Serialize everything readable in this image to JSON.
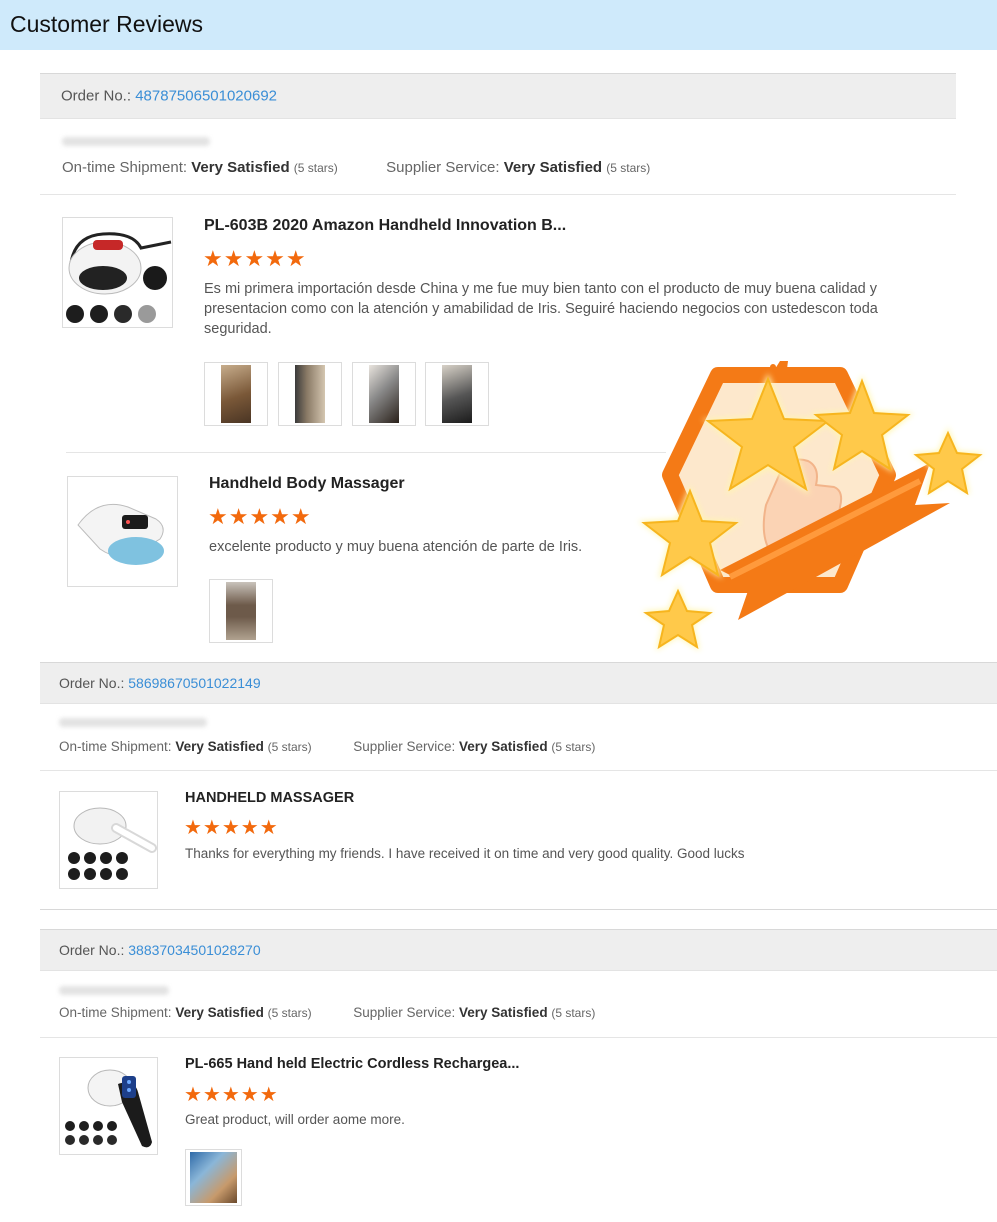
{
  "header": {
    "title": "Customer Reviews"
  },
  "labels": {
    "order_no": "Order No.:",
    "on_time": "On-time Shipment:",
    "supplier": "Supplier Service:"
  },
  "colors": {
    "header_bg": "#cfeafb",
    "order_link": "#3a8ed6",
    "star": "#f2690d"
  },
  "orders": [
    {
      "number": "48787506501020692",
      "shipment_rating": "Very Satisfied",
      "shipment_stars": "(5 stars)",
      "service_rating": "Very Satisfied",
      "service_stars": "(5 stars)",
      "items": [
        {
          "name": "PL-603B 2020 Amazon Handheld Innovation B...",
          "stars": "★★★★★",
          "rating": 5,
          "review": "Es mi primera importación desde China y me fue muy bien tanto con el producto de muy buena calidad y presentacion como con la atención y amabilidad de Iris. Seguiré haciendo negocios con ustedescon toda seguridad.",
          "photo_count": 4
        },
        {
          "name": "Handheld Body Massager",
          "stars": "★★★★★",
          "rating": 5,
          "review": "excelente producto y muy buena atención de parte de Iris.",
          "photo_count": 1
        }
      ]
    },
    {
      "number": "58698670501022149",
      "shipment_rating": "Very Satisfied",
      "shipment_stars": "(5 stars)",
      "service_rating": "Very Satisfied",
      "service_stars": "(5 stars)",
      "items": [
        {
          "name": "HANDHELD MASSAGER",
          "stars": "★★★★★",
          "rating": 5,
          "review": "Thanks for everything my friends. I have received it on time and very good quality. Good lucks",
          "photo_count": 0
        }
      ]
    },
    {
      "number": "38837034501028270",
      "shipment_rating": "Very Satisfied",
      "shipment_stars": "(5 stars)",
      "service_rating": "Very Satisfied",
      "service_stars": "(5 stars)",
      "items": [
        {
          "name": "PL-665 Hand held Electric Cordless Rechargea...",
          "stars": "★★★★★",
          "rating": 5,
          "review": "Great product, will order aome more.",
          "photo_count": 1
        }
      ]
    }
  ]
}
